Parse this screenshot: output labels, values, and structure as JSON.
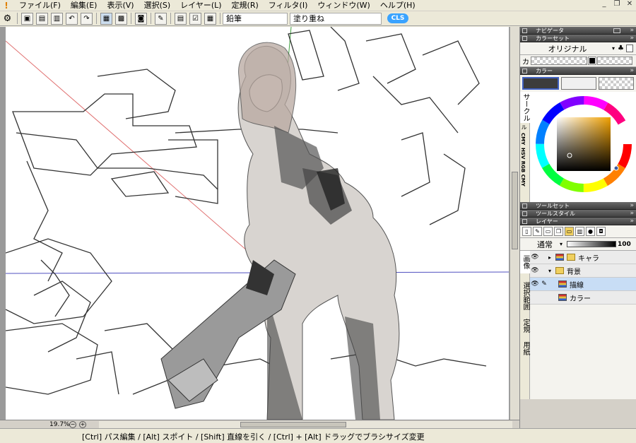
{
  "menubar": {
    "items": [
      "ファイル(F)",
      "編集(E)",
      "表示(V)",
      "選択(S)",
      "レイヤー(L)",
      "定規(R)",
      "フィルタ(I)",
      "ウィンドウ(W)",
      "ヘルプ(H)"
    ]
  },
  "toolbar": {
    "tool_name": "鉛筆",
    "blend_mode": "塗り重ね",
    "logo": "CLS"
  },
  "canvas": {
    "zoom": "19.7%"
  },
  "status": {
    "text": "[Ctrl] パス編集 / [Alt] スポイト / [Shift] 直線を引く / [Ctrl] + [Alt] ドラッグでブラシサイズ変更"
  },
  "panels": {
    "navigator": {
      "title": "ナビゲータ"
    },
    "color_set": {
      "title": "カラーセット",
      "set_name": "オリジナル",
      "row_label": "カ"
    },
    "color": {
      "title": "カラー",
      "tabs": [
        "サークル",
        "RGB",
        "CMY",
        "HSV RGB CMY"
      ],
      "tab_short": "ル",
      "fg_color": "#3c3c3c",
      "bg_color": "#f0f0f0"
    },
    "tool_set": {
      "title": "ツールセット"
    },
    "tool_style": {
      "title": "ツールスタイル"
    },
    "layer": {
      "title": "レイヤー",
      "blend_mode": "通常",
      "opacity": "100",
      "side_tabs": [
        "画像",
        "選択範囲",
        "定規",
        "用紙"
      ],
      "layers": [
        {
          "name": "キャラ",
          "type": "folder",
          "visible": true,
          "selected": false,
          "indent": 0
        },
        {
          "name": "背景",
          "type": "folder",
          "visible": true,
          "selected": false,
          "indent": 0
        },
        {
          "name": "描線",
          "type": "raster",
          "visible": true,
          "selected": true,
          "indent": 1
        },
        {
          "name": "カラー",
          "type": "raster",
          "visible": false,
          "selected": false,
          "indent": 1
        }
      ]
    }
  }
}
